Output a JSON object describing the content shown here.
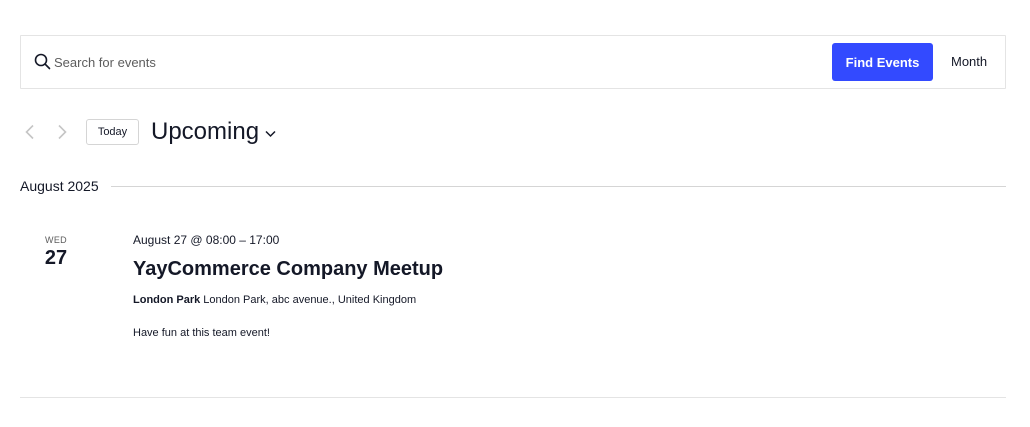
{
  "search": {
    "placeholder": "Search for events",
    "find_label": "Find Events",
    "view_label": "Month"
  },
  "nav": {
    "today_label": "Today",
    "view_title": "Upcoming"
  },
  "month_heading": "August 2025",
  "event": {
    "weekday": "WED",
    "day": "27",
    "datetime": "August 27 @ 08:00 – 17:00",
    "title": "YayCommerce Company Meetup",
    "venue_name": "London Park",
    "venue_address": "London Park, abc avenue., United Kingdom",
    "description": "Have fun at this team event!"
  },
  "colors": {
    "accent": "#334aff",
    "text": "#141827",
    "muted": "#5d5d5d",
    "border": "#e4e4e4"
  },
  "icons": {
    "search": "search-icon",
    "prev": "chevron-left-icon",
    "next": "chevron-right-icon",
    "view_dropdown": "chevron-down-icon"
  }
}
